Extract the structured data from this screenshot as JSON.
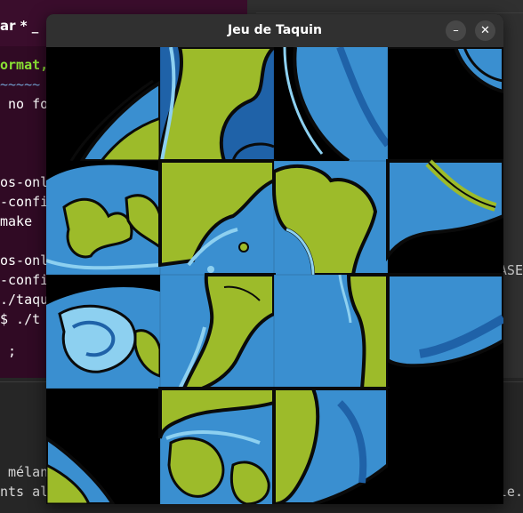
{
  "window": {
    "title": "Jeu de Taquin",
    "minimize_icon": "minimize-icon",
    "close_icon": "close-icon",
    "minimize_label": "–",
    "close_label": "✕"
  },
  "puzzle": {
    "grid": 4,
    "tiles": [
      {
        "piece": 1,
        "view": "earth-edge-left"
      },
      {
        "piece": 2,
        "view": "earth-top-green"
      },
      {
        "piece": 3,
        "view": "ocean-top"
      },
      {
        "piece": 4,
        "view": "space-ring"
      },
      {
        "piece": 5,
        "view": "ocean-land-left"
      },
      {
        "piece": 6,
        "view": "land-bay"
      },
      {
        "piece": 7,
        "view": "continent"
      },
      {
        "piece": 8,
        "view": "ocean-right"
      },
      {
        "piece": 9,
        "view": "ocean-swirl"
      },
      {
        "piece": 10,
        "view": "land-mid"
      },
      {
        "piece": 11,
        "view": "land-ocean"
      },
      {
        "piece": 12,
        "view": "ocean-shadow"
      },
      {
        "piece": 13,
        "view": "space-bottom-left"
      },
      {
        "piece": 14,
        "view": "islands"
      },
      {
        "piece": 15,
        "view": "land-bottom"
      },
      {
        "piece": 0,
        "view": "empty"
      }
    ],
    "colors": {
      "ocean": "#3a8fd0",
      "ocean_light": "#8dd0f0",
      "ocean_dark": "#1f62a8",
      "land": "#9dbb2a",
      "land_dark": "#4f7a16",
      "outline": "#0a0a0a",
      "space": "#000000"
    }
  },
  "background": {
    "terminal_left": {
      "header": "ar * _",
      "lines": [
        "ormat,",
        "~~~~~",
        " no fo",
        "",
        "",
        "os-onl",
        "-confi",
        "make",
        "",
        "os-onl",
        "-confi",
        "./taqu",
        "$ ./t",
        "",
        " ;"
      ]
    },
    "terminal_right": {
      "ase": "ASE"
    },
    "terminal_bottom": {
      "line1": " mélan",
      "line2": "nts al",
      "tail": "le."
    }
  }
}
